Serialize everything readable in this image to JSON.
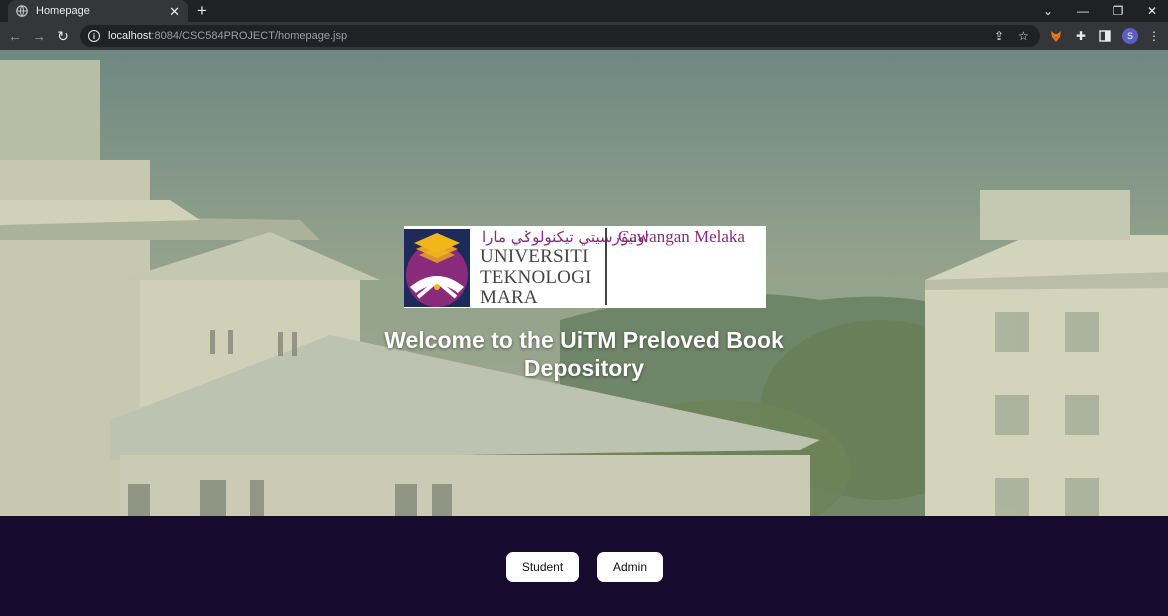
{
  "browser": {
    "tab_title": "Homepage",
    "new_tab_label": "+",
    "url_host": "localhost",
    "url_path": ":8084/CSC584PROJECT/homepage.jsp",
    "profile_initial": "S"
  },
  "hero": {
    "logo": {
      "jawi_text": "اونيۏرسيتي تيكنولوݢي مارا",
      "line1": "UNIVERSITI",
      "line2": "TEKNOLOGI",
      "line3": "MARA",
      "campus": "Cawangan Melaka"
    },
    "welcome_line1": "Welcome to the UiTM Preloved Book",
    "welcome_line2": "Depository"
  },
  "footer": {
    "student_label": "Student",
    "admin_label": "Admin"
  },
  "colors": {
    "footer_bg": "#160a2f",
    "logo_purple": "#8a2a7a",
    "logo_gold": "#f2b61b"
  }
}
